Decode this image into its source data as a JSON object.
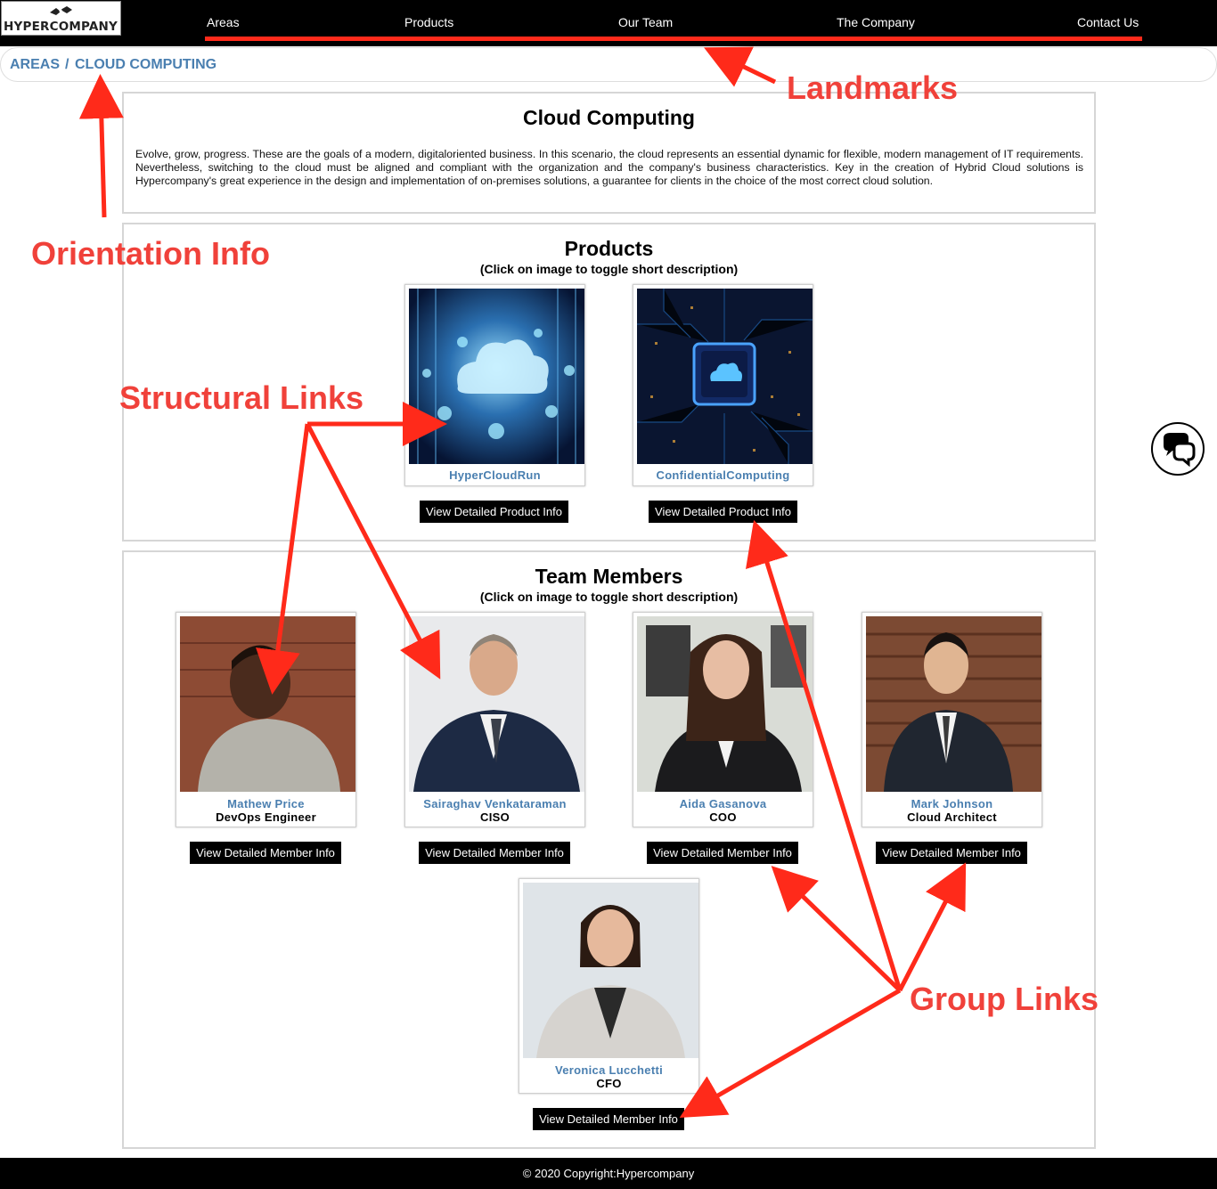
{
  "logo": {
    "text": "HYPERCOMPANY"
  },
  "nav": {
    "items": [
      {
        "label": "Areas"
      },
      {
        "label": "Products"
      },
      {
        "label": "Our Team"
      },
      {
        "label": "The Company"
      },
      {
        "label": "Contact Us"
      }
    ]
  },
  "breadcrumb": {
    "root": "AREAS",
    "separator": "/",
    "current": "CLOUD COMPUTING"
  },
  "intro": {
    "title": "Cloud Computing",
    "body": "Evolve, grow, progress. These are the goals of a modern, digitaloriented business. In this scenario, the cloud represents an essential dynamic for flexible, modern management of IT requirements. Nevertheless, switching to the cloud must be aligned and compliant with the organization and the company's business characteristics. Key in the creation of Hybrid Cloud solutions is Hypercompany's great experience in the design and implementation of on-premises solutions, a guarantee for clients in the choice of the most correct cloud solution."
  },
  "products": {
    "title": "Products",
    "subtitle": "(Click on image to toggle short description)",
    "items": [
      {
        "name": "HyperCloudRun",
        "button": "View Detailed Product Info"
      },
      {
        "name": "ConfidentialComputing",
        "button": "View Detailed Product Info"
      }
    ]
  },
  "team": {
    "title": "Team Members",
    "subtitle": "(Click on image to toggle short description)",
    "members": [
      {
        "name": "Mathew Price",
        "role": "DevOps Engineer",
        "button": "View Detailed Member Info"
      },
      {
        "name": "Sairaghav Venkataraman",
        "role": "CISO",
        "button": "View Detailed Member Info"
      },
      {
        "name": "Aida Gasanova",
        "role": "COO",
        "button": "View Detailed Member Info"
      },
      {
        "name": "Mark Johnson",
        "role": "Cloud Architect",
        "button": "View Detailed Member Info"
      },
      {
        "name": "Veronica Lucchetti",
        "role": "CFO",
        "button": "View Detailed Member Info"
      }
    ]
  },
  "footer": {
    "text": "© 2020 Copyright:Hypercompany"
  },
  "annotations": {
    "landmarks": "Landmarks",
    "orientation": "Orientation Info",
    "structural": "Structural Links",
    "group": "Group Links"
  },
  "colors": {
    "accent": "#ff2a1a",
    "link": "#4a7fb0",
    "annotation": "#f0413a"
  },
  "icons": {
    "chat": "chat-bubbles-icon"
  }
}
